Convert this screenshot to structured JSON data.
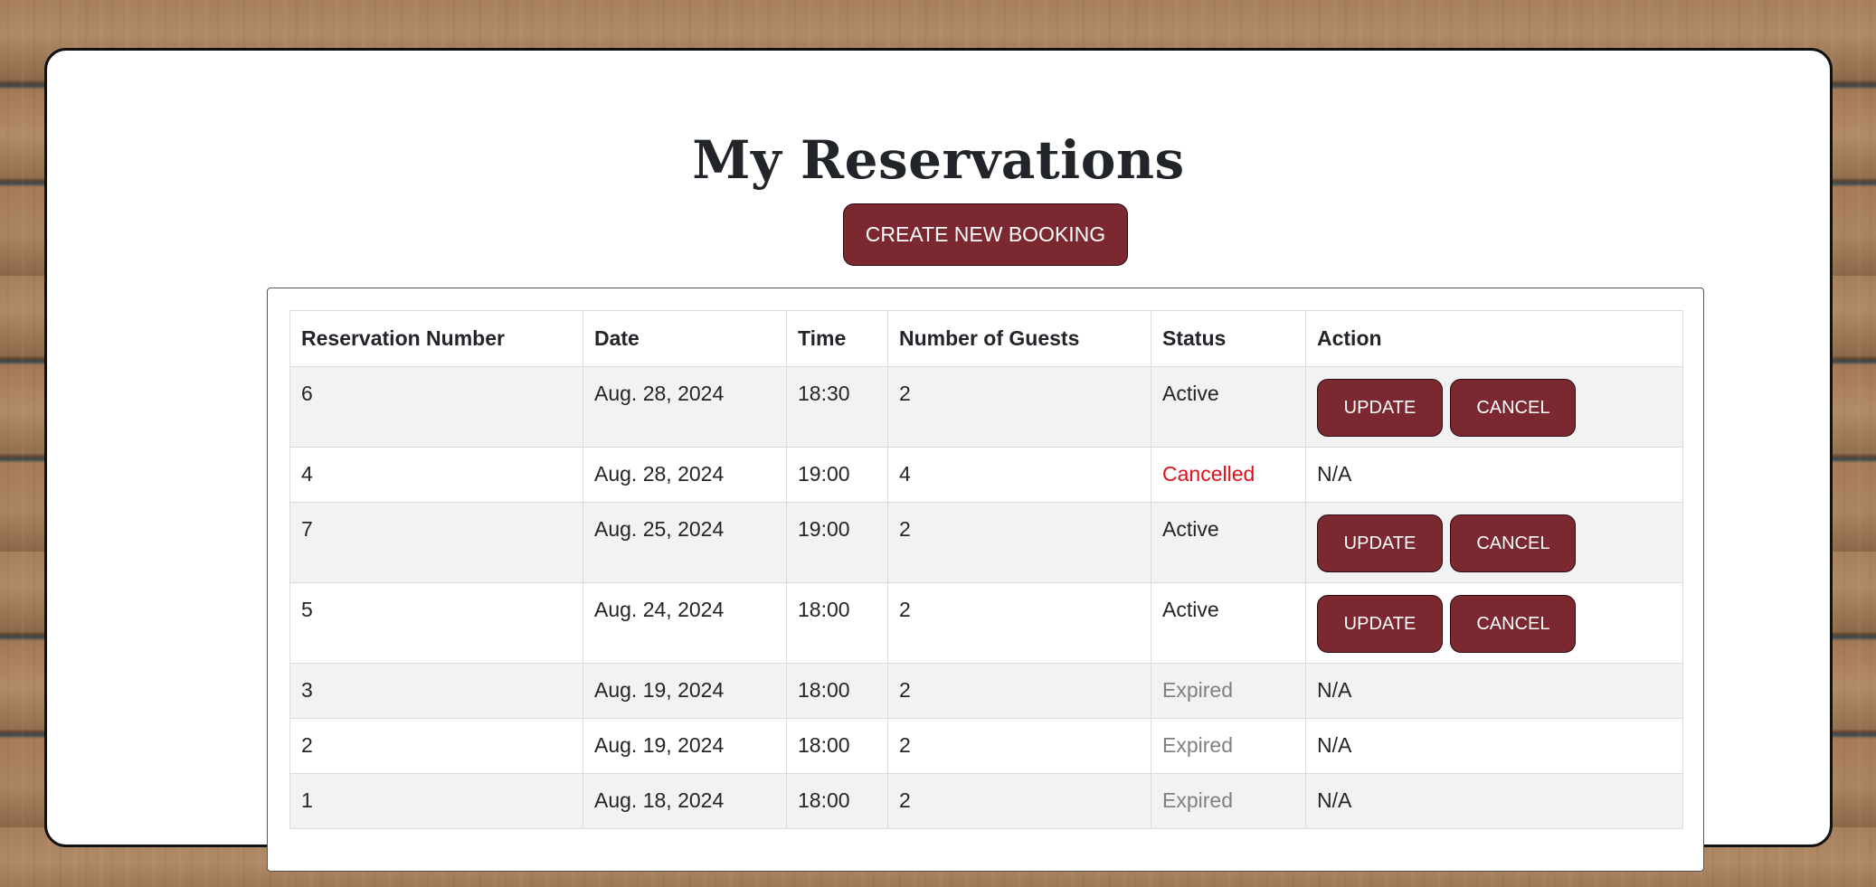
{
  "title": "My Reservations",
  "create_button": "CREATE NEW BOOKING",
  "table": {
    "headers": [
      "Reservation Number",
      "Date",
      "Time",
      "Number of Guests",
      "Status",
      "Action"
    ],
    "rows": [
      {
        "number": "6",
        "date": "Aug. 28, 2024",
        "time": "18:30",
        "guests": "2",
        "status": "Active",
        "action": {
          "update": "UPDATE",
          "cancel": "CANCEL"
        }
      },
      {
        "number": "4",
        "date": "Aug. 28, 2024",
        "time": "19:00",
        "guests": "4",
        "status": "Cancelled",
        "action": "N/A"
      },
      {
        "number": "7",
        "date": "Aug. 25, 2024",
        "time": "19:00",
        "guests": "2",
        "status": "Active",
        "action": {
          "update": "UPDATE",
          "cancel": "CANCEL"
        }
      },
      {
        "number": "5",
        "date": "Aug. 24, 2024",
        "time": "18:00",
        "guests": "2",
        "status": "Active",
        "action": {
          "update": "UPDATE",
          "cancel": "CANCEL"
        }
      },
      {
        "number": "3",
        "date": "Aug. 19, 2024",
        "time": "18:00",
        "guests": "2",
        "status": "Expired",
        "action": "N/A"
      },
      {
        "number": "2",
        "date": "Aug. 19, 2024",
        "time": "18:00",
        "guests": "2",
        "status": "Expired",
        "action": "N/A"
      },
      {
        "number": "1",
        "date": "Aug. 18, 2024",
        "time": "18:00",
        "guests": "2",
        "status": "Expired",
        "action": "N/A"
      }
    ]
  },
  "colors": {
    "button_bg": "#7b2830",
    "cancelled_status": "#e0101b",
    "expired_status": "#808080",
    "row_stripe": "#f2f2f2"
  }
}
